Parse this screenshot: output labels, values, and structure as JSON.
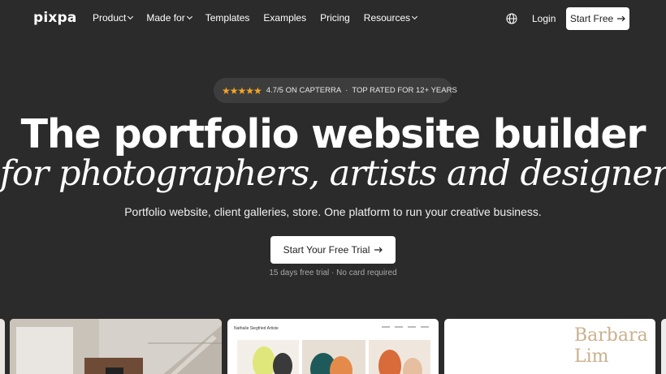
{
  "brand": {
    "logo_text": "pixpa"
  },
  "nav": {
    "items": [
      {
        "label": "Product",
        "has_dropdown": true
      },
      {
        "label": "Made for",
        "has_dropdown": true
      },
      {
        "label": "Templates",
        "has_dropdown": false
      },
      {
        "label": "Examples",
        "has_dropdown": false
      },
      {
        "label": "Pricing",
        "has_dropdown": false
      },
      {
        "label": "Resources",
        "has_dropdown": true
      }
    ],
    "globe_icon": "globe-icon",
    "login_label": "Login",
    "start_free_label": "Start Free",
    "arrow_icon": "arrow-right-icon"
  },
  "badge": {
    "stars": "★★★★★",
    "rating_text": "4.7/5 ON CAPTERRA",
    "separator": "·",
    "award_text": "TOP RATED FOR 12+ YEARS"
  },
  "hero": {
    "title": "The portfolio website builder",
    "subtitle": "for photographers, artists and designers",
    "tagline": "Portfolio website, client galleries, store. One platform to run your creative business.",
    "cta_label": "Start Your Free Trial",
    "cta_note": "15 days free trial · No card required"
  },
  "showcase": {
    "card2_title": "Nathalie Siegfried Artiste",
    "card3_name_line1": "Barbara",
    "card3_name_line2": "Lim"
  },
  "colors": {
    "background": "#2b2b2b",
    "badge_bg": "#3d3d3d",
    "star": "#f5a623",
    "button_bg": "#ffffff",
    "accent_text": "#c9b18d"
  }
}
